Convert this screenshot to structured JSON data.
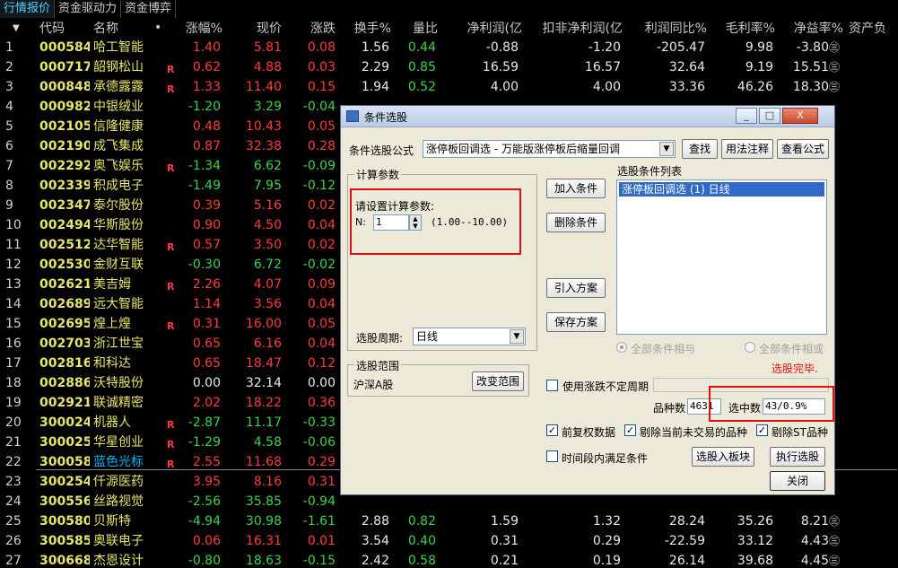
{
  "tabs": [
    "行情报价",
    "资金驱动力",
    "资金博弈"
  ],
  "header": {
    "sort_arrow": "▼",
    "code": "代码",
    "name": "名称",
    "dot": "•",
    "change_pct": "涨幅%",
    "price": "现价",
    "change": "涨跌",
    "turnover": "换手%",
    "vol_ratio": "量比",
    "net_profit": "净利润(亿",
    "deduct_profit": "扣非净利润(亿",
    "profit_yoy": "利润同比%",
    "gross_margin": "毛利率%",
    "roe": "净益率%",
    "assets": "资产负"
  },
  "rows": [
    {
      "n": "1",
      "code": "000584",
      "name": "哈工智能",
      "flag": "",
      "chg": "1.40",
      "price": "5.81",
      "diff": "0.08",
      "turn": "1.56",
      "vr": "0.44",
      "np": "-0.88",
      "dnp": "-1.20",
      "yoy": "-205.47",
      "gm": "9.98",
      "roe": "-3.80",
      "dir": "up"
    },
    {
      "n": "2",
      "code": "000717",
      "name": "韶钢松山",
      "flag": "R",
      "chg": "0.62",
      "price": "4.88",
      "diff": "0.03",
      "turn": "2.29",
      "vr": "0.85",
      "np": "16.59",
      "dnp": "16.57",
      "yoy": "32.64",
      "gm": "9.19",
      "roe": "15.51",
      "dir": "up"
    },
    {
      "n": "3",
      "code": "000848",
      "name": "承德露露",
      "flag": "R",
      "chg": "1.33",
      "price": "11.40",
      "diff": "0.15",
      "turn": "1.94",
      "vr": "0.52",
      "np": "4.00",
      "dnp": "4.00",
      "yoy": "33.36",
      "gm": "46.26",
      "roe": "18.30",
      "dir": "up"
    },
    {
      "n": "4",
      "code": "000982",
      "name": "中银绒业",
      "flag": "",
      "chg": "-1.20",
      "price": "3.29",
      "diff": "-0.04",
      "turn": "",
      "vr": "",
      "np": "",
      "dnp": "",
      "yoy": "",
      "gm": "",
      "roe": "",
      "dir": "down"
    },
    {
      "n": "5",
      "code": "002105",
      "name": "信隆健康",
      "flag": "",
      "chg": "0.48",
      "price": "10.43",
      "diff": "0.05",
      "turn": "",
      "vr": "",
      "np": "",
      "dnp": "",
      "yoy": "",
      "gm": "",
      "roe": "",
      "dir": "up"
    },
    {
      "n": "6",
      "code": "002190",
      "name": "成飞集成",
      "flag": "",
      "chg": "0.87",
      "price": "32.38",
      "diff": "0.28",
      "turn": "",
      "vr": "",
      "np": "",
      "dnp": "",
      "yoy": "",
      "gm": "",
      "roe": "",
      "dir": "up"
    },
    {
      "n": "7",
      "code": "002292",
      "name": "奥飞娱乐",
      "flag": "R",
      "chg": "-1.34",
      "price": "6.62",
      "diff": "-0.09",
      "turn": "",
      "vr": "",
      "np": "",
      "dnp": "",
      "yoy": "",
      "gm": "",
      "roe": "",
      "dir": "down"
    },
    {
      "n": "8",
      "code": "002339",
      "name": "积成电子",
      "flag": "",
      "chg": "-1.49",
      "price": "7.95",
      "diff": "-0.12",
      "turn": "",
      "vr": "",
      "np": "",
      "dnp": "",
      "yoy": "",
      "gm": "",
      "roe": "",
      "dir": "down"
    },
    {
      "n": "9",
      "code": "002347",
      "name": "泰尔股份",
      "flag": "",
      "chg": "0.39",
      "price": "5.16",
      "diff": "0.02",
      "turn": "",
      "vr": "",
      "np": "",
      "dnp": "",
      "yoy": "",
      "gm": "",
      "roe": "",
      "dir": "up"
    },
    {
      "n": "10",
      "code": "002494",
      "name": "华斯股份",
      "flag": "",
      "chg": "0.90",
      "price": "4.50",
      "diff": "0.04",
      "turn": "",
      "vr": "",
      "np": "",
      "dnp": "",
      "yoy": "",
      "gm": "",
      "roe": "",
      "dir": "up"
    },
    {
      "n": "11",
      "code": "002512",
      "name": "达华智能",
      "flag": "R",
      "chg": "0.57",
      "price": "3.50",
      "diff": "0.02",
      "turn": "",
      "vr": "",
      "np": "",
      "dnp": "",
      "yoy": "",
      "gm": "",
      "roe": "",
      "dir": "up"
    },
    {
      "n": "12",
      "code": "002530",
      "name": "金财互联",
      "flag": "",
      "chg": "-0.30",
      "price": "6.72",
      "diff": "-0.02",
      "turn": "",
      "vr": "",
      "np": "",
      "dnp": "",
      "yoy": "",
      "gm": "",
      "roe": "",
      "dir": "down"
    },
    {
      "n": "13",
      "code": "002621",
      "name": "美吉姆",
      "flag": "R",
      "chg": "2.26",
      "price": "4.07",
      "diff": "0.09",
      "turn": "",
      "vr": "",
      "np": "",
      "dnp": "",
      "yoy": "",
      "gm": "",
      "roe": "",
      "dir": "up"
    },
    {
      "n": "14",
      "code": "002689",
      "name": "远大智能",
      "flag": "",
      "chg": "1.14",
      "price": "3.56",
      "diff": "0.04",
      "turn": "",
      "vr": "",
      "np": "",
      "dnp": "",
      "yoy": "",
      "gm": "",
      "roe": "",
      "dir": "up"
    },
    {
      "n": "15",
      "code": "002695",
      "name": "煌上煌",
      "flag": "R",
      "chg": "0.31",
      "price": "16.00",
      "diff": "0.05",
      "turn": "",
      "vr": "",
      "np": "",
      "dnp": "",
      "yoy": "",
      "gm": "",
      "roe": "",
      "dir": "up"
    },
    {
      "n": "16",
      "code": "002703",
      "name": "浙江世宝",
      "flag": "",
      "chg": "0.65",
      "price": "6.16",
      "diff": "0.04",
      "turn": "",
      "vr": "",
      "np": "",
      "dnp": "",
      "yoy": "",
      "gm": "",
      "roe": "",
      "dir": "up"
    },
    {
      "n": "17",
      "code": "002816",
      "name": "和科达",
      "flag": "",
      "chg": "0.65",
      "price": "18.47",
      "diff": "0.12",
      "turn": "",
      "vr": "",
      "np": "",
      "dnp": "",
      "yoy": "",
      "gm": "",
      "roe": "",
      "dir": "up"
    },
    {
      "n": "18",
      "code": "002886",
      "name": "沃特股份",
      "flag": "",
      "chg": "0.00",
      "price": "32.14",
      "diff": "0.00",
      "turn": "",
      "vr": "",
      "np": "",
      "dnp": "",
      "yoy": "",
      "gm": "",
      "roe": "",
      "dir": "flat"
    },
    {
      "n": "19",
      "code": "002921",
      "name": "联诚精密",
      "flag": "",
      "chg": "2.02",
      "price": "18.22",
      "diff": "0.36",
      "turn": "",
      "vr": "",
      "np": "",
      "dnp": "",
      "yoy": "",
      "gm": "",
      "roe": "",
      "dir": "up"
    },
    {
      "n": "20",
      "code": "300024",
      "name": "机器人",
      "flag": "R",
      "chg": "-2.87",
      "price": "11.17",
      "diff": "-0.33",
      "turn": "",
      "vr": "",
      "np": "",
      "dnp": "",
      "yoy": "",
      "gm": "",
      "roe": "",
      "dir": "down"
    },
    {
      "n": "21",
      "code": "300025",
      "name": "华星创业",
      "flag": "R",
      "chg": "-1.29",
      "price": "4.58",
      "diff": "-0.06",
      "turn": "",
      "vr": "",
      "np": "",
      "dnp": "",
      "yoy": "",
      "gm": "",
      "roe": "",
      "dir": "down"
    },
    {
      "n": "22",
      "code": "300058",
      "name": "蓝色光标",
      "flag": "R",
      "chg": "2.55",
      "price": "11.68",
      "diff": "0.29",
      "turn": "",
      "vr": "",
      "np": "",
      "dnp": "",
      "yoy": "",
      "gm": "",
      "roe": "",
      "dir": "up",
      "selected": true
    },
    {
      "n": "23",
      "code": "300254",
      "name": "仟源医药",
      "flag": "",
      "chg": "3.95",
      "price": "8.16",
      "diff": "0.31",
      "turn": "",
      "vr": "",
      "np": "",
      "dnp": "",
      "yoy": "",
      "gm": "",
      "roe": "",
      "dir": "up"
    },
    {
      "n": "24",
      "code": "300556",
      "name": "丝路视觉",
      "flag": "",
      "chg": "-2.56",
      "price": "35.85",
      "diff": "-0.94",
      "turn": "",
      "vr": "",
      "np": "",
      "dnp": "",
      "yoy": "",
      "gm": "",
      "roe": "",
      "dir": "down"
    },
    {
      "n": "25",
      "code": "300580",
      "name": "贝斯特",
      "flag": "",
      "chg": "-4.94",
      "price": "30.98",
      "diff": "-1.61",
      "turn": "2.88",
      "vr": "0.82",
      "np": "1.59",
      "dnp": "1.32",
      "yoy": "28.24",
      "gm": "35.26",
      "roe": "8.21",
      "dir": "down"
    },
    {
      "n": "26",
      "code": "300585",
      "name": "奥联电子",
      "flag": "",
      "chg": "0.06",
      "price": "16.31",
      "diff": "0.01",
      "turn": "3.54",
      "vr": "0.40",
      "np": "0.31",
      "dnp": "0.29",
      "yoy": "-22.59",
      "gm": "33.12",
      "roe": "4.43",
      "dir": "up"
    },
    {
      "n": "27",
      "code": "300668",
      "name": "杰恩设计",
      "flag": "",
      "chg": "-0.80",
      "price": "18.63",
      "diff": "-0.15",
      "turn": "2.42",
      "vr": "0.58",
      "np": "0.21",
      "dnp": "0.19",
      "yoy": "26.14",
      "gm": "39.68",
      "roe": "4.45",
      "dir": "down"
    }
  ],
  "dialog": {
    "title": "条件选股",
    "min": "_",
    "max": "□",
    "close": "X",
    "formula_label": "条件选股公式",
    "formula_value": "涨停板回调选 - 万能版涨停板后缩量回调",
    "btn_find": "查找",
    "btn_usage": "用法注释",
    "btn_view": "查看公式",
    "calc_group": "计算参数",
    "param_prompt": "请设置计算参数:",
    "param_n_label": "N:",
    "param_n_value": "1",
    "param_range": "(1.00--10.00)",
    "period_label": "选股周期:",
    "period_value": "日线",
    "btn_add": "加入条件",
    "btn_delete": "删除条件",
    "btn_import": "引入方案",
    "btn_save": "保存方案",
    "cond_list_label": "选股条件列表",
    "cond_item": "涨停板回调选 (1) 日线",
    "radio_and": "全部条件相与",
    "radio_or": "全部条件相或",
    "done": "选股完毕.",
    "range_group": "选股范围",
    "range_value": "沪深A股",
    "btn_change_range": "改变范围",
    "use_period_label": "使用涨跌不定周期",
    "count_label": "品种数",
    "count_value": "4631",
    "selected_label": "选中数",
    "selected_value": "43/0.9%",
    "chk_fq": "前复权数据",
    "chk_exclude": "剔除当前未交易的品种",
    "chk_st": "剔除ST品种",
    "chk_period": "时间段内满足条件",
    "btn_to_block": "选股入板块",
    "btn_run": "执行选股",
    "btn_close": "关闭"
  },
  "colors": {
    "up": "#ff3b3b",
    "down": "#3bd24e",
    "code": "#e6e66a",
    "selected": "#00b4ff",
    "highlight_box": "#e01010"
  }
}
